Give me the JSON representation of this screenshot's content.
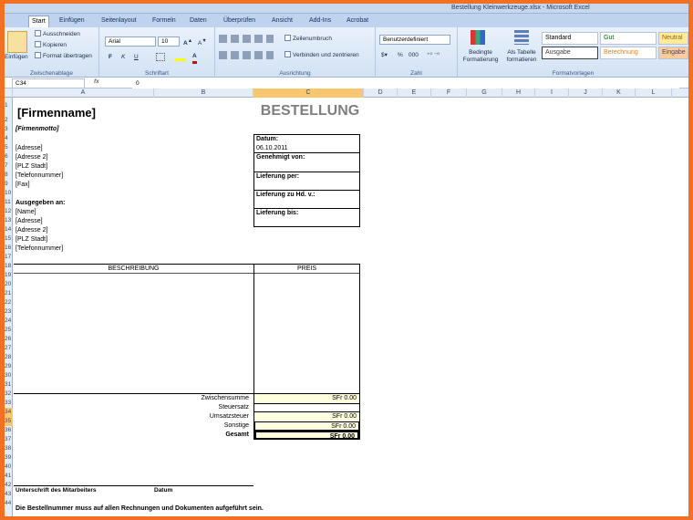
{
  "window": {
    "title": "Bestellung Kleinwerkzeuge.xlsx - Microsoft Excel"
  },
  "ribbon": {
    "tabs": [
      "Start",
      "Einfügen",
      "Seitenlayout",
      "Formeln",
      "Daten",
      "Überprüfen",
      "Ansicht",
      "Add-Ins",
      "Acrobat"
    ],
    "clipboard": {
      "paste": "Einfügen",
      "cut": "Ausschneiden",
      "copy": "Kopieren",
      "format_painter": "Format übertragen",
      "group": "Zwischenablage"
    },
    "font": {
      "name": "Arial",
      "size": "10",
      "group": "Schriftart",
      "bold": "F",
      "italic": "K",
      "underline": "U"
    },
    "alignment": {
      "wrap": "Zeilenumbruch",
      "merge": "Verbinden und zentrieren",
      "group": "Ausrichtung"
    },
    "number": {
      "format": "Benutzerdefiniert",
      "percent": "%",
      "thousands": "000",
      "group": "Zahl"
    },
    "styles": {
      "conditional": "Bedingte Formatierung",
      "as_table": "Als Tabelle formatieren",
      "group": "Formatvorlagen",
      "cells": [
        {
          "label": "Standard",
          "color": "#000000",
          "bg": "#ffffff"
        },
        {
          "label": "Gut",
          "color": "#006100",
          "bg": "#ffffff"
        },
        {
          "label": "Neutral",
          "color": "#9c6500",
          "bg": "#ffeb9c"
        },
        {
          "label": "Ausgabe",
          "color": "#3f3f3f",
          "bg": "#ffffff"
        },
        {
          "label": "Berechnung",
          "color": "#fa7d00",
          "bg": "#ffffff"
        },
        {
          "label": "Eingabe",
          "color": "#3f3f76",
          "bg": "#ffcc99"
        }
      ]
    }
  },
  "formula_bar": {
    "name_box": "C34",
    "fx": "fx",
    "value": "0"
  },
  "columns": [
    "A",
    "B",
    "C",
    "D",
    "E",
    "F",
    "G",
    "H",
    "I",
    "J",
    "K",
    "L"
  ],
  "selected_column": "C",
  "rows": [
    "1",
    "2",
    "3",
    "4",
    "5",
    "6",
    "7",
    "8",
    "9",
    "10",
    "11",
    "12",
    "13",
    "14",
    "15",
    "16",
    "17",
    "18",
    "19",
    "20",
    "21",
    "22",
    "23",
    "24",
    "25",
    "26",
    "27",
    "28",
    "29",
    "30",
    "31",
    "32",
    "33",
    "34",
    "35",
    "36",
    "37",
    "38",
    "39",
    "40",
    "41",
    "42",
    "43",
    "44"
  ],
  "selected_rows": [
    "34",
    "35"
  ],
  "sheet": {
    "company": "[Firmenname]",
    "motto": "[Firmenmotto]",
    "title": "BESTELLUNG",
    "address": [
      "[Adresse]",
      "[Adresse 2]",
      "[PLZ Stadt]",
      "[Telefonnummer]",
      "[Fax]"
    ],
    "issued_to_label": "Ausgegeben an:",
    "issued_to": [
      "[Name]",
      "[Adresse]",
      "[Adresse 2]",
      "[PLZ Stadt]",
      "[Telefonnummer]"
    ],
    "info": {
      "date_label": "Datum:",
      "date_value": "06.10.2011",
      "approved_label": "Genehmigt von:",
      "delivery_label": "Lieferung per:",
      "attn_label": "Lieferung zu Hd. v.:",
      "until_label": "Lieferung bis:"
    },
    "table": {
      "desc_header": "BESCHREIBUNG",
      "price_header": "PREIS"
    },
    "totals": [
      {
        "label": "Zwischensumme",
        "value": "SFr  0.00"
      },
      {
        "label": "Steuersatz",
        "value": ""
      },
      {
        "label": "Umsatzsteuer",
        "value": "SFr  0.00"
      },
      {
        "label": "Sonstige",
        "value": "SFr  0.00"
      },
      {
        "label": "Gesamt",
        "value": "SFr  0.00"
      }
    ],
    "signature_label": "Unterschrift des Mitarbeiters",
    "date_sig_label": "Datum",
    "footer_note": "Die Bestellnummer muss auf allen Rechnungen und Dokumenten aufgeführt sein."
  }
}
